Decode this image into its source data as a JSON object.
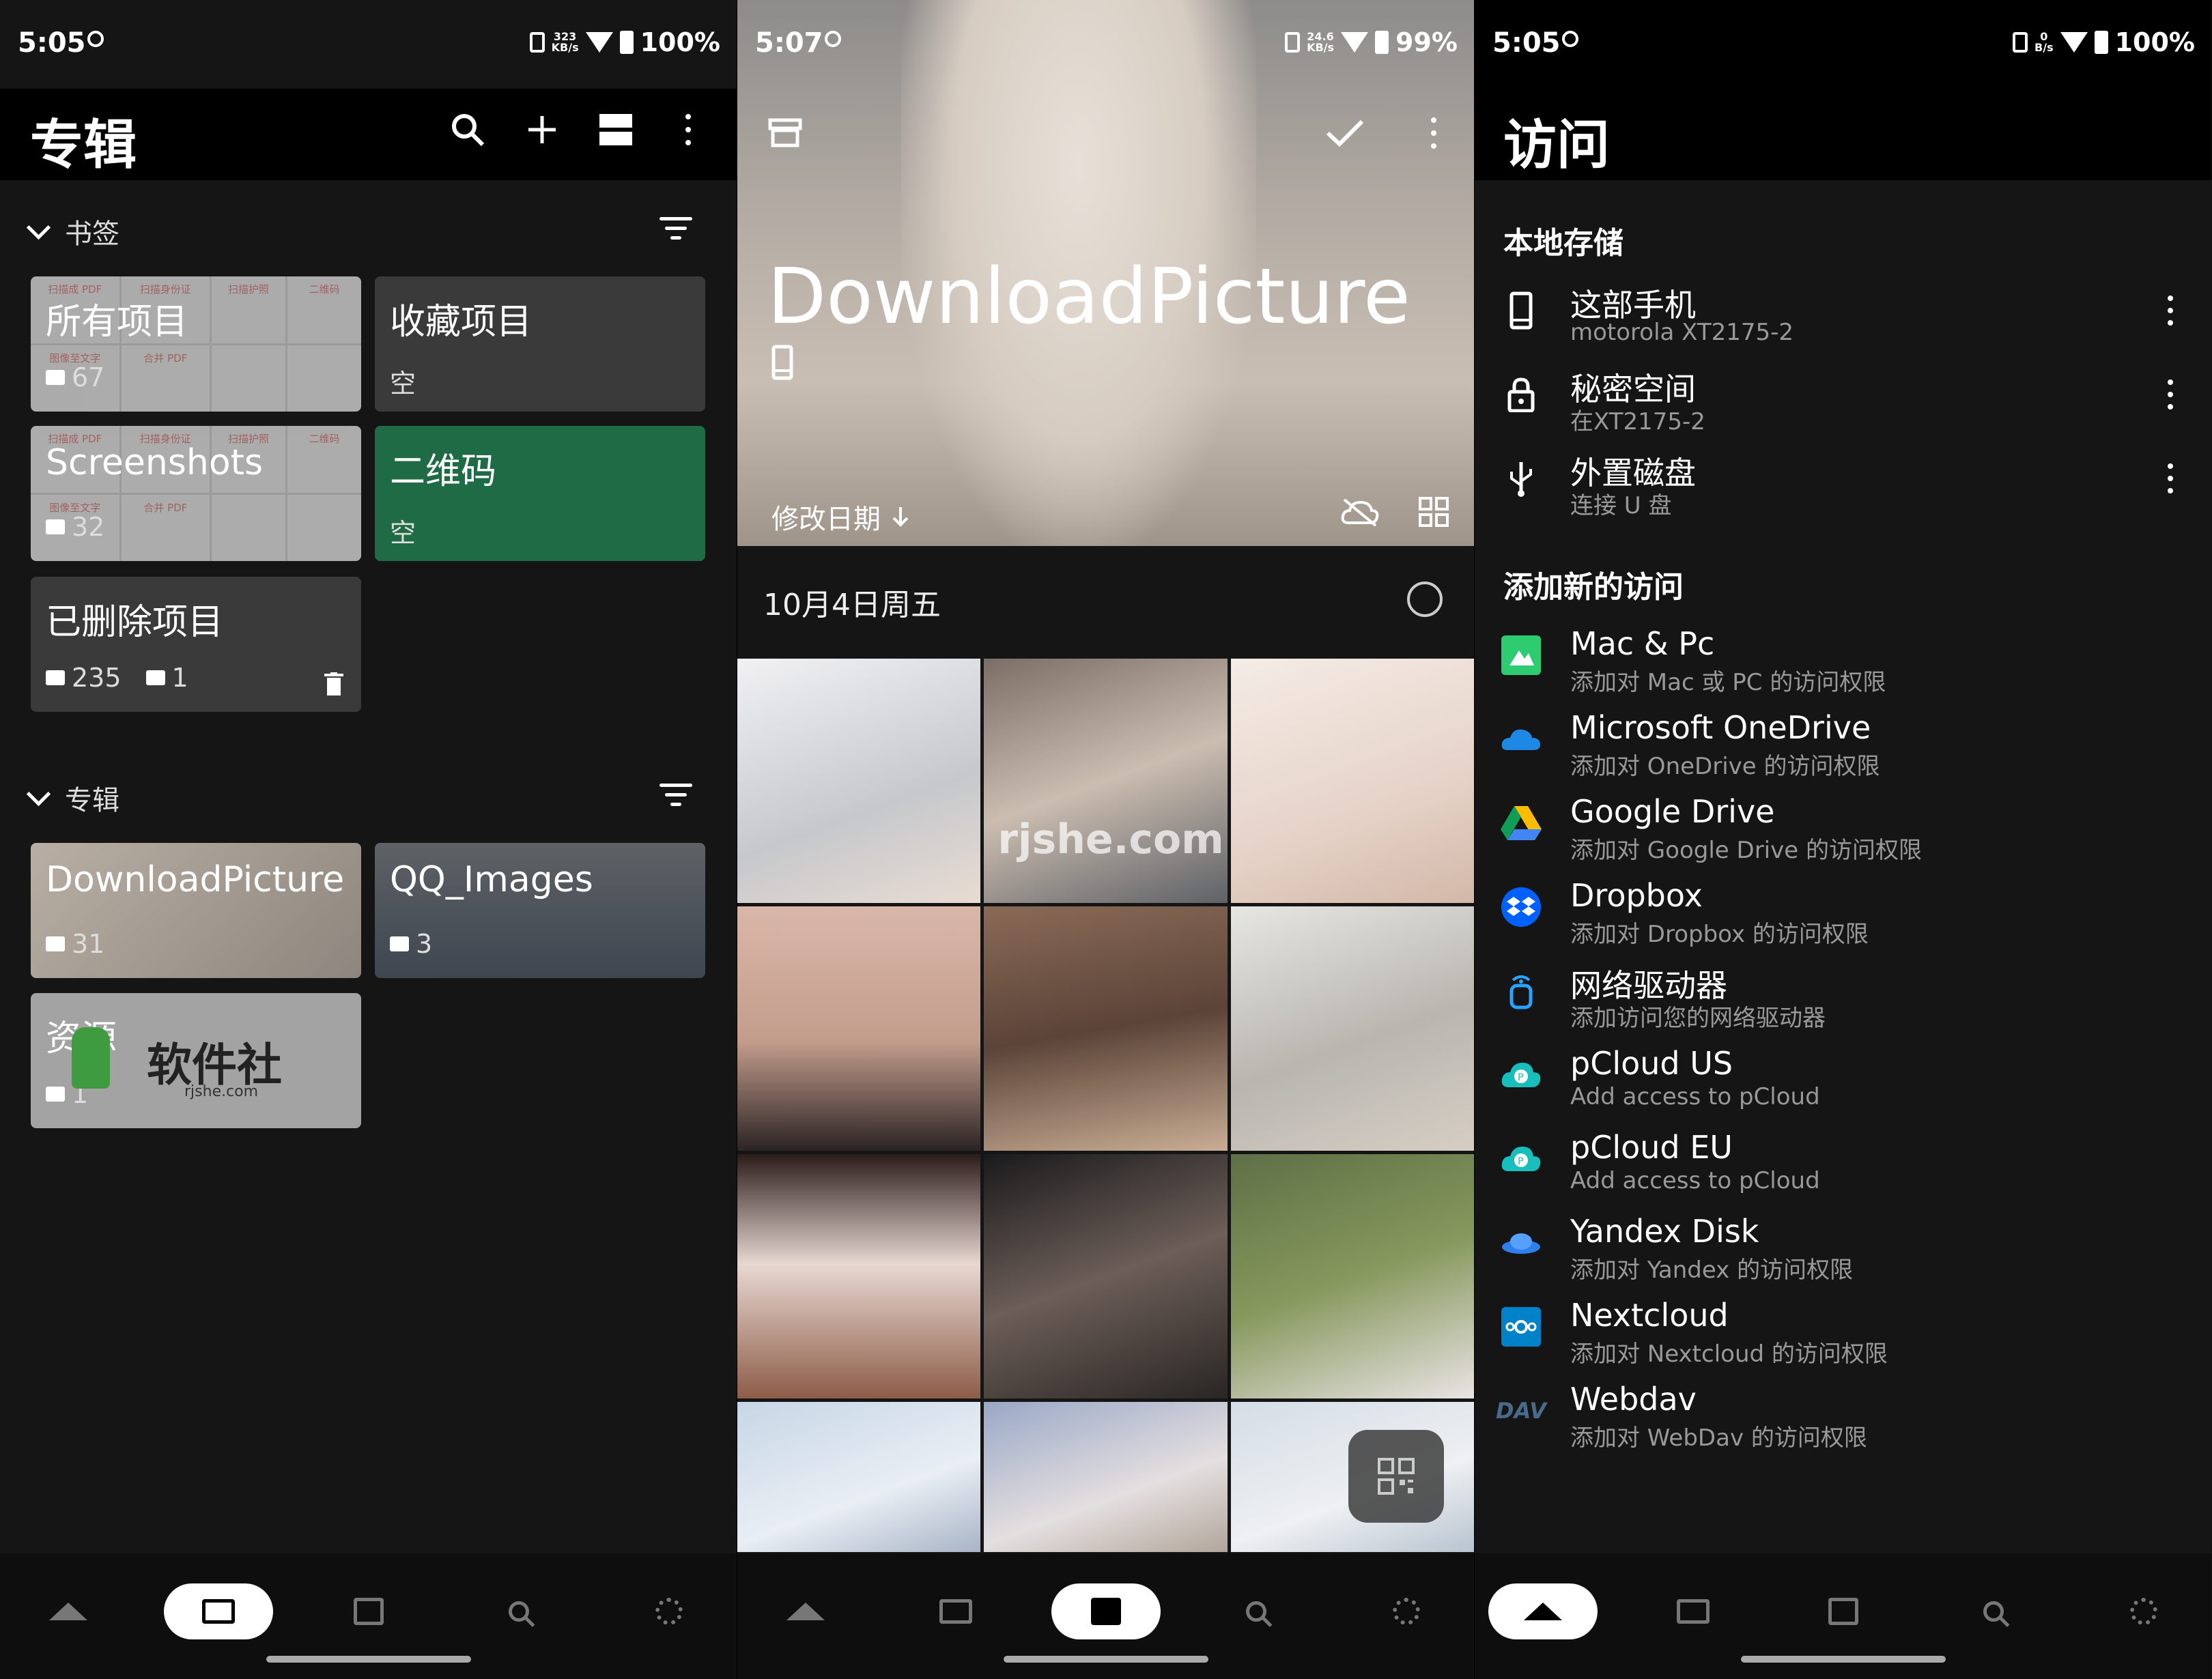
{
  "left_panel": {
    "status": {
      "time": "5:05",
      "net_top": "323",
      "net_bottom": "KB/s",
      "battery": "100%"
    },
    "title": "专辑",
    "bookmarks_section": "书签",
    "albums_section": "专辑",
    "bookmark_cards": [
      {
        "title": "所有项目",
        "count": "67"
      },
      {
        "title": "收藏项目",
        "sub": "空"
      },
      {
        "title": "Screenshots",
        "count": "32"
      },
      {
        "title": "二维码",
        "sub": "空"
      },
      {
        "title": "已删除项目",
        "count_images": "235",
        "count_videos": "1"
      }
    ],
    "thumb_labels": [
      "扫描成 PDF",
      "扫描身份证",
      "扫描护照",
      "二维码",
      "图像至文字",
      "合并 PDF"
    ],
    "album_cards": [
      {
        "title": "DownloadPicture",
        "count": "31"
      },
      {
        "title": "QQ_Images",
        "count": "3"
      },
      {
        "title": "资源",
        "count": "1"
      }
    ],
    "watermark": {
      "title": "软件社",
      "url": "rjshe.com"
    }
  },
  "middle_panel": {
    "status": {
      "time": "5:07",
      "net_top": "24.6",
      "net_bottom": "KB/s",
      "battery": "99%"
    },
    "hero_title": "DownloadPicture",
    "sort_label": "修改日期",
    "date_header": "10月4日周五",
    "watermark": "rjshe.com"
  },
  "right_panel": {
    "status": {
      "time": "5:05",
      "net_top": "0",
      "net_bottom": "B/s",
      "battery": "100%"
    },
    "title": "访问",
    "local_section": "本地存储",
    "local_items": [
      {
        "title": "这部手机",
        "sub": "motorola XT2175-2"
      },
      {
        "title": "秘密空间",
        "sub": "在XT2175-2"
      },
      {
        "title": "外置磁盘",
        "sub": "连接 U 盘"
      }
    ],
    "add_section": "添加新的访问",
    "add_items": [
      {
        "title": "Mac & Pc",
        "sub": "添加对 Mac 或 PC 的访问权限",
        "color": "#2ecc71"
      },
      {
        "title": "Microsoft OneDrive",
        "sub": "添加对 OneDrive 的访问权限",
        "color": "#1e88e5"
      },
      {
        "title": "Google Drive",
        "sub": "添加对 Google Drive 的访问权限",
        "color": "#fbbc04"
      },
      {
        "title": "Dropbox",
        "sub": "添加对 Dropbox 的访问权限",
        "color": "#0061ff"
      },
      {
        "title": "网络驱动器",
        "sub": "添加访问您的网络驱动器",
        "color": "#29a3ff"
      },
      {
        "title": "pCloud US",
        "sub": "Add access to pCloud",
        "color": "#17bebb"
      },
      {
        "title": "pCloud EU",
        "sub": "Add access to pCloud",
        "color": "#17bebb"
      },
      {
        "title": "Yandex Disk",
        "sub": "添加对 Yandex 的访问权限",
        "color": "#2f80ed"
      },
      {
        "title": "Nextcloud",
        "sub": "添加对 Nextcloud 的访问权限",
        "color": "#0082c9"
      },
      {
        "title": "Webdav",
        "sub": "添加对 WebDav 的访问权限",
        "color": "#4a6a8a"
      }
    ],
    "webdav_icon_text": "DAV"
  }
}
